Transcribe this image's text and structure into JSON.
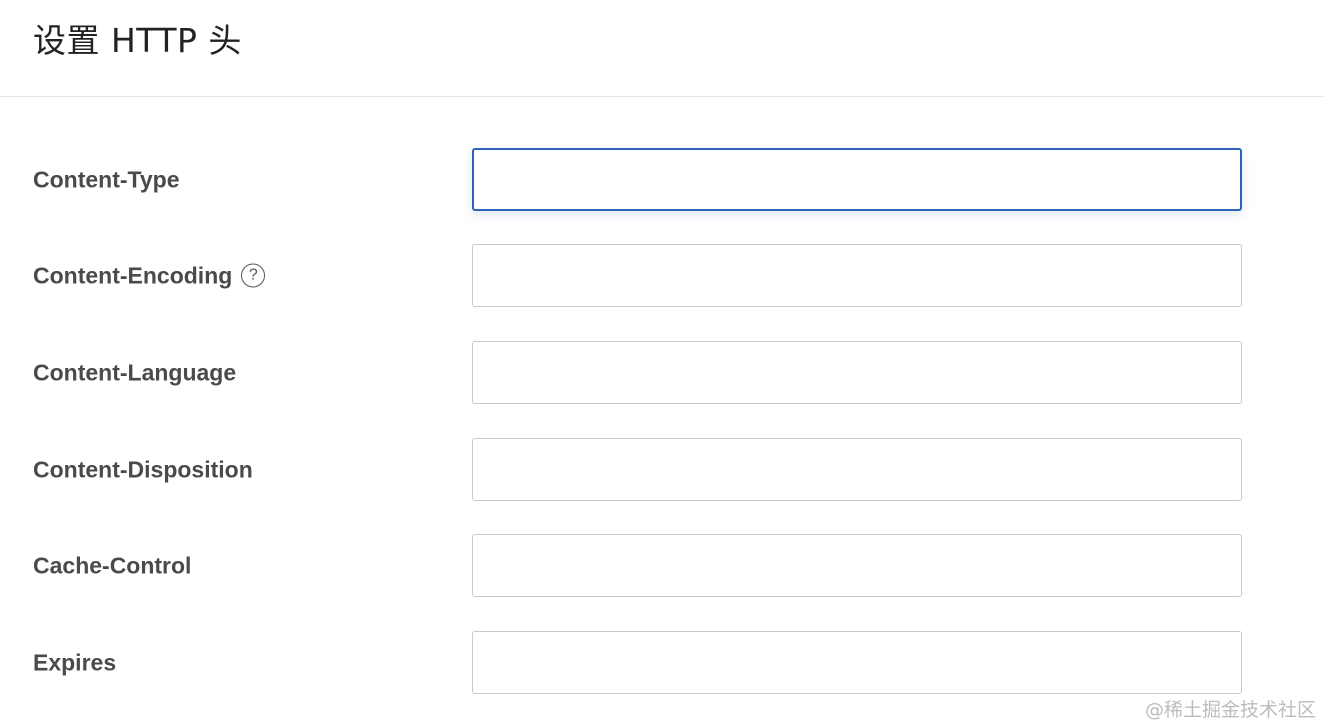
{
  "dialog": {
    "title": "设置 HTTP 头"
  },
  "fields": [
    {
      "label": "Content-Type",
      "value": "",
      "focused": true
    },
    {
      "label": "Content-Encoding",
      "value": "",
      "help_icon": "question-circle-icon"
    },
    {
      "label": "Content-Language",
      "value": ""
    },
    {
      "label": "Content-Disposition",
      "value": ""
    },
    {
      "label": "Cache-Control",
      "value": ""
    },
    {
      "label": "Expires",
      "value": ""
    }
  ],
  "watermark": "@稀土掘金技术社区",
  "colors": {
    "focus_border": "#2e63b8",
    "input_border": "#c9c9c9",
    "label_text": "#4a4a4a",
    "divider": "#e6e6e6"
  }
}
